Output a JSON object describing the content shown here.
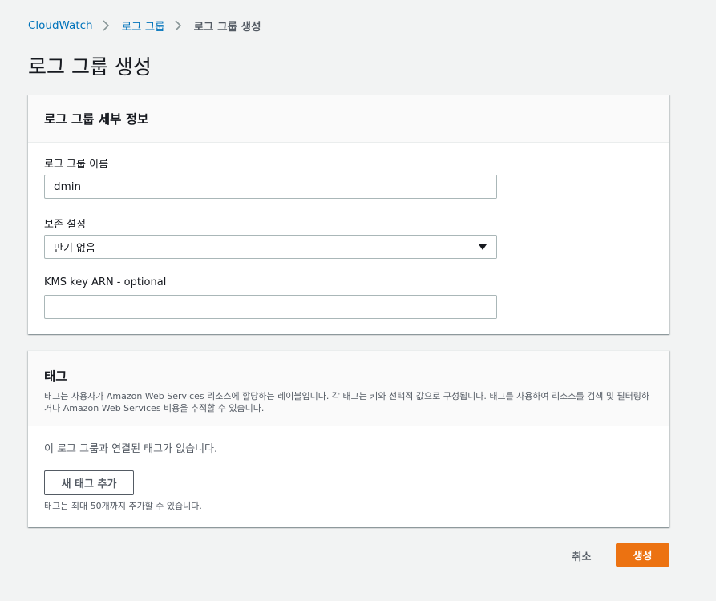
{
  "breadcrumb": {
    "items": [
      "CloudWatch",
      "로그 그룹",
      "로그 그룹 생성"
    ]
  },
  "page": {
    "title": "로그 그룹 생성"
  },
  "details": {
    "title": "로그 그룹 세부 정보",
    "log_group_name": {
      "label": "로그 그룹 이름",
      "value": "dmin"
    },
    "retention": {
      "label": "보존 설정",
      "selected": "만기 없음"
    },
    "kms": {
      "label": "KMS key ARN - optional",
      "value": ""
    }
  },
  "tags": {
    "title": "태그",
    "description": "태그는 사용자가 Amazon Web Services 리소스에 할당하는 레이블입니다. 각 태그는 키와 선택적 값으로 구성됩니다. 태그를 사용하여 리소스를 검색 및 필터링하거나 Amazon Web Services 비용을 추적할 수 있습니다.",
    "empty_message": "이 로그 그룹과 연결된 태그가 없습니다.",
    "add_button": "새 태그 추가",
    "limit_text": "태그는 최대 50개까지 추가할 수 있습니다."
  },
  "actions": {
    "cancel": "취소",
    "create": "생성"
  },
  "colors": {
    "link": "#0073bb",
    "primary_button": "#ec7211",
    "background": "#f2f3f3"
  }
}
